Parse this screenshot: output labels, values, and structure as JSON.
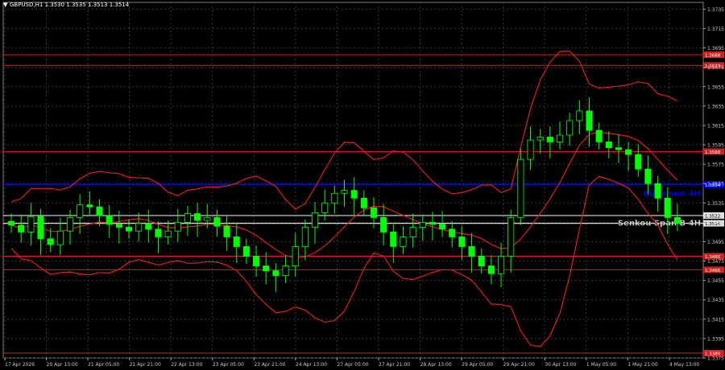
{
  "header": {
    "symbol_info": "GBPUSD,H1  1.3530 1.3535 1.3513 1.3514"
  },
  "colors": {
    "background": "#000000",
    "grid": "#3a3a3a",
    "candle_up": "#00ff00",
    "candle_down": "#00ff00",
    "bollinger": "#e02020",
    "kijun": "#0000ff",
    "senkou": "#e0e0e0",
    "level_line": "#d02020",
    "axis_text": "#c8c8c8"
  },
  "y_axis": {
    "ticks": [
      "1.3735",
      "1.3715",
      "1.3695",
      "1.3675",
      "1.3655",
      "1.3635",
      "1.3615",
      "1.3595",
      "1.3575",
      "1.3555",
      "1.3535",
      "1.3515",
      "1.3495",
      "1.3475",
      "1.3455",
      "1.3435",
      "1.3415",
      "1.3395",
      "1.3375"
    ],
    "min": 1.3375,
    "max": 1.3742
  },
  "x_axis": {
    "labels": [
      "17 Apr 2026",
      "20 Apr 13:00",
      "21 Apr 05:00",
      "21 Apr 21:00",
      "22 Apr 13:00",
      "23 Apr 05:00",
      "23 Apr 21:00",
      "24 Apr 13:00",
      "27 Apr 05:00",
      "27 Apr 21:00",
      "28 Apr 13:00",
      "29 Apr 05:00",
      "29 Apr 21:00",
      "30 Apr 13:00",
      "1 May 05:00",
      "1 May 21:00",
      "4 May 13:00"
    ]
  },
  "levels": [
    {
      "price": 1.3688,
      "label": "1.3688",
      "kind": "resistance"
    },
    {
      "price": 1.3677,
      "label": "1.3677",
      "kind": "resistance"
    },
    {
      "price": 1.3588,
      "label": "1.3588",
      "kind": "resistance"
    },
    {
      "price": 1.3554,
      "label": "1.3554",
      "kind": "kijun",
      "text": "Kijun-sen 4H"
    },
    {
      "price": 1.3522,
      "label": "1.3522",
      "kind": "senkou_label"
    },
    {
      "price": 1.3514,
      "label": "1.3514",
      "kind": "senkou",
      "text": "Senkou Span B 4H"
    },
    {
      "price": 1.348,
      "label": "1.3480",
      "kind": "support"
    },
    {
      "price": 1.3466,
      "label": "1.3466",
      "kind": "support"
    },
    {
      "price": 1.338,
      "label": "1.3380",
      "kind": "support"
    }
  ],
  "chart_data": {
    "type": "candlestick",
    "title": "GBPUSD,H1",
    "ylim": [
      1.3375,
      1.3742
    ],
    "closes": [
      1.3512,
      1.3505,
      1.3521,
      1.3498,
      1.3492,
      1.3506,
      1.352,
      1.3533,
      1.3531,
      1.3522,
      1.3513,
      1.351,
      1.3506,
      1.3514,
      1.3508,
      1.35,
      1.3506,
      1.3515,
      1.3524,
      1.3517,
      1.352,
      1.3511,
      1.35,
      1.349,
      1.348,
      1.347,
      1.3465,
      1.346,
      1.347,
      1.349,
      1.351,
      1.3525,
      1.3535,
      1.3545,
      1.3548,
      1.354,
      1.353,
      1.352,
      1.3505,
      1.349,
      1.35,
      1.351,
      1.3515,
      1.3513,
      1.3508,
      1.35,
      1.349,
      1.348,
      1.347,
      1.3462,
      1.348,
      1.352,
      1.358,
      1.36,
      1.3603,
      1.3598,
      1.3605,
      1.362,
      1.363,
      1.361,
      1.3598,
      1.3592,
      1.359,
      1.3585,
      1.357,
      1.3555,
      1.354,
      1.352,
      1.3514
    ]
  }
}
